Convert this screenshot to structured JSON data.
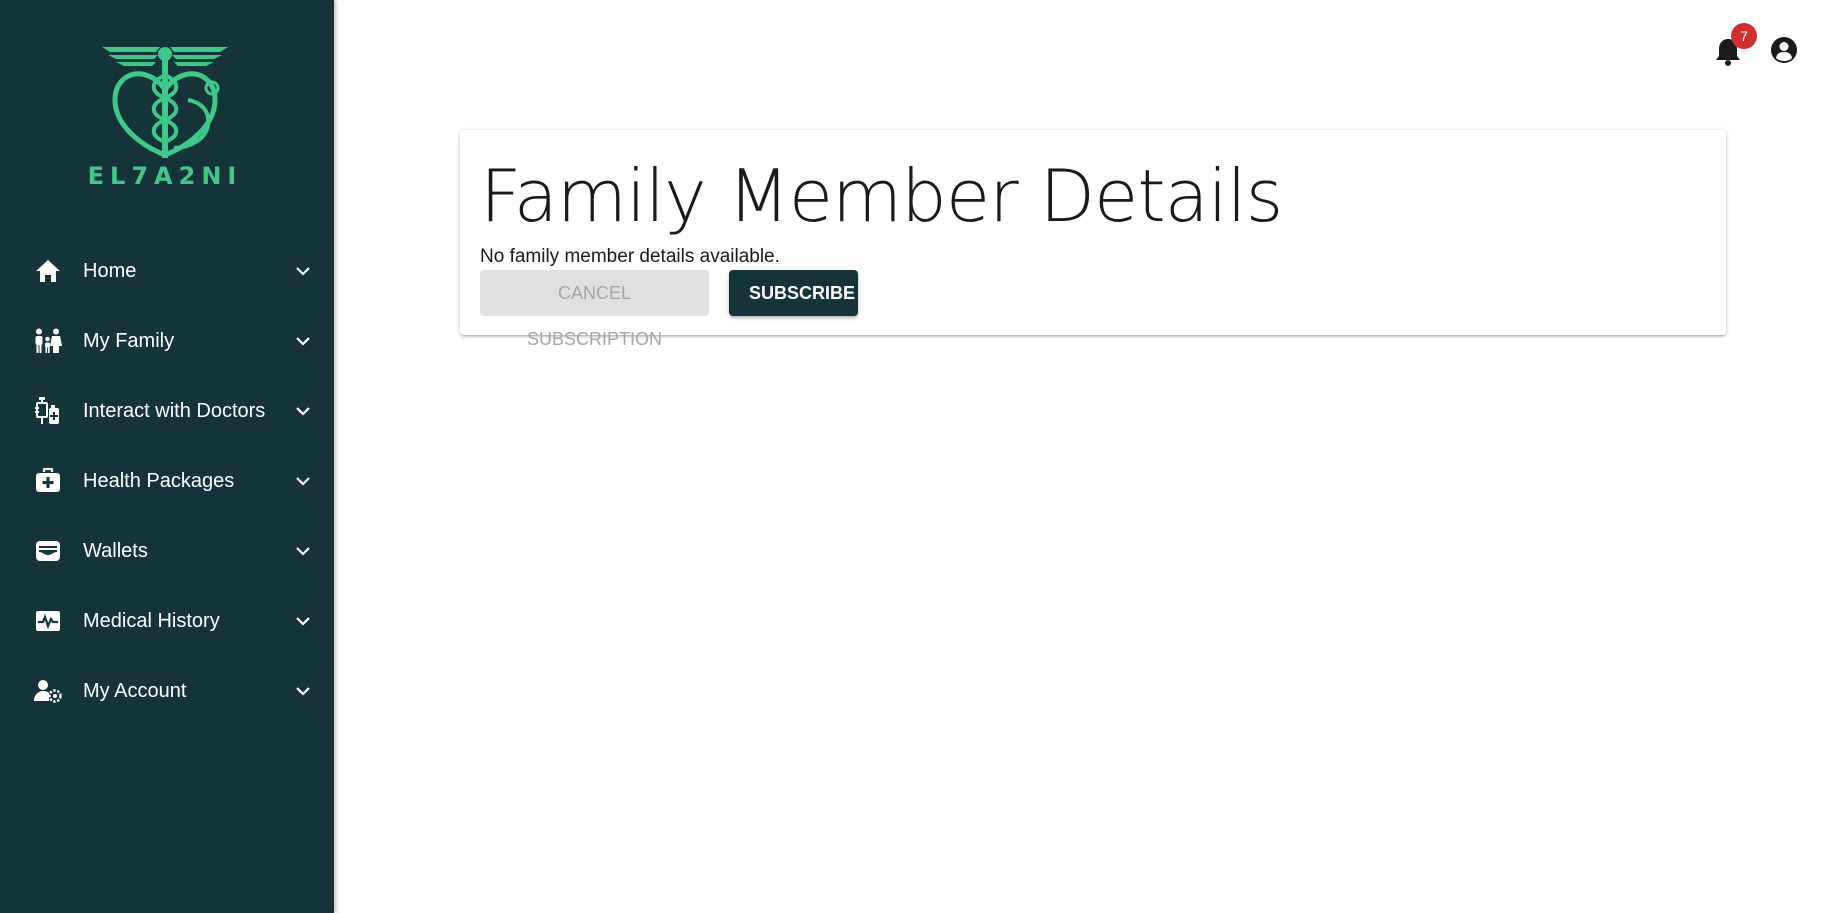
{
  "brand": {
    "name": "EL7A2NI",
    "color": "#3cc98a"
  },
  "sidebar": {
    "background": "#14343a",
    "items": [
      {
        "label": "Home",
        "icon": "home-icon"
      },
      {
        "label": "My Family",
        "icon": "family-icon"
      },
      {
        "label": "Interact with Doctors",
        "icon": "doctor-icon"
      },
      {
        "label": "Health Packages",
        "icon": "medical-kit-icon"
      },
      {
        "label": "Wallets",
        "icon": "wallet-icon"
      },
      {
        "label": "Medical History",
        "icon": "heartbeat-icon"
      },
      {
        "label": "My Account",
        "icon": "user-gear-icon"
      }
    ]
  },
  "topbar": {
    "notification_count": "7",
    "notification_icon": "bell-icon",
    "account_icon": "account-circle-icon"
  },
  "main": {
    "title": "Family Member Details",
    "message": "No family member details available.",
    "cancel_label": "CANCEL SUBSCRIPTION",
    "subscribe_label": "SUBSCRIBE"
  }
}
